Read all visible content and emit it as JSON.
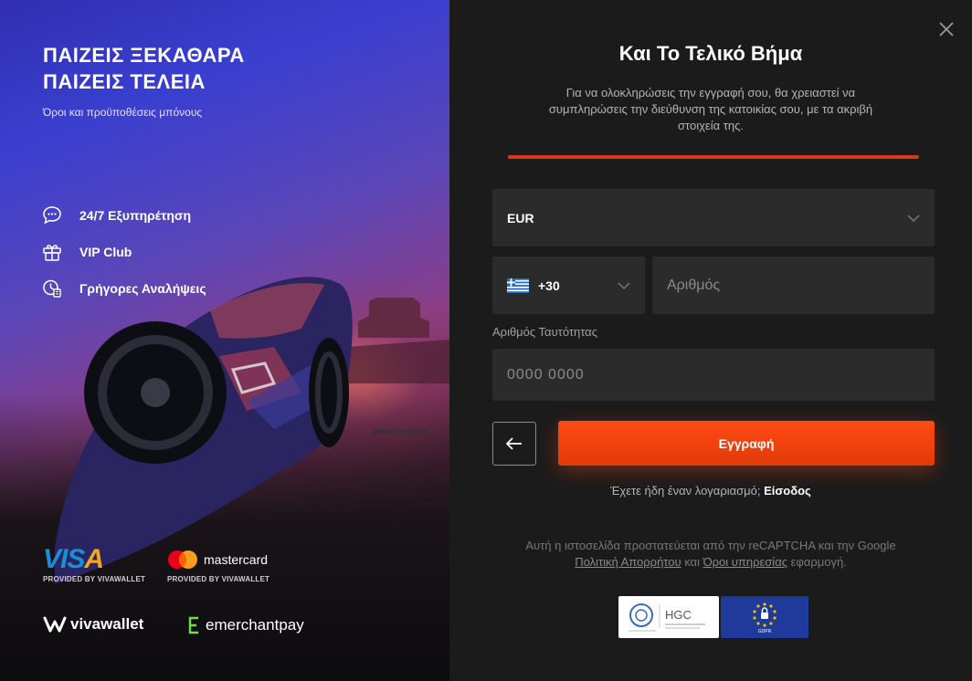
{
  "promo": {
    "title_line1": "ΠΑΙΖΕΙΣ ΞΕΚΑΘΑΡΑ",
    "title_line2": "ΠΑΙΖΕΙΣ ΤΕΛΕΙΑ",
    "terms_link": "Όροι και προϋποθέσεις μπόνους",
    "features": [
      {
        "icon": "support-chat-icon",
        "label": "24/7 Εξυπηρέτηση"
      },
      {
        "icon": "vip-gift-icon",
        "label": "VIP Club"
      },
      {
        "icon": "fast-withdrawal-clock-icon",
        "label": "Γρήγορες Αναλήψεις"
      }
    ],
    "payments": {
      "visa": "VISA",
      "visa_caption": "PROVIDED BY VIVAWALLET",
      "mastercard": "mastercard",
      "mastercard_caption": "PROVIDED BY VIVAWALLET",
      "vivawallet": "vivawallet",
      "emerchantpay": "emerchantpay"
    }
  },
  "form": {
    "title": "Και Το Τελικό Βήμα",
    "subtitle": "Για να ολοκληρώσεις την εγγραφή σου, θα χρειαστεί να συμπληρώσεις την διεύθυνση της κατοικίας σου, με τα ακριβή στοιχεία της.",
    "currency": {
      "value": "EUR"
    },
    "phone": {
      "country_code": "+30",
      "placeholder": "Αριθμός"
    },
    "id_field": {
      "label": "Αριθμός Ταυτότητας",
      "placeholder": "0000 0000"
    },
    "submit_label": "Εγγραφή",
    "login_prompt": "Έχετε ήδη έναν λογαριασμό;",
    "login_link": "Είσοδος",
    "recaptcha": {
      "text_before": "Αυτή η ιστοσελίδα προστατεύεται από την reCAPTCHA και την Google",
      "privacy_link": "Πολιτική Απορρήτου",
      "and": "και",
      "terms_link": "Όροι υπηρεσίας",
      "text_after": "εφαρμογή."
    },
    "badges": {
      "hgc": "HGC",
      "eu": "GDPR"
    }
  },
  "colors": {
    "accent": "#e23a0a",
    "panel": "#1b1b1b",
    "field": "#2b2b2b"
  }
}
